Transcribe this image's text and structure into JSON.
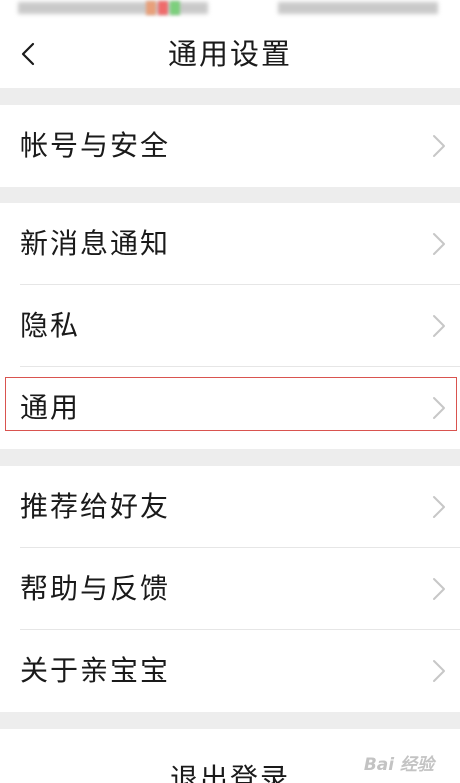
{
  "header": {
    "title": "通用设置",
    "back_icon": "chevron-left-icon"
  },
  "groups": [
    {
      "items": [
        {
          "label": "帐号与安全"
        }
      ]
    },
    {
      "items": [
        {
          "label": "新消息通知"
        },
        {
          "label": "隐私"
        },
        {
          "label": "通用"
        }
      ]
    },
    {
      "items": [
        {
          "label": "推荐给好友"
        },
        {
          "label": "帮助与反馈"
        },
        {
          "label": "关于亲宝宝"
        }
      ]
    }
  ],
  "logout": {
    "label": "退出登录"
  },
  "watermark": {
    "text": "Bai 经验"
  },
  "colors": {
    "background": "#ededed",
    "card": "#ffffff",
    "highlight_border": "#d9534f",
    "chevron": "#c7c7c7"
  }
}
